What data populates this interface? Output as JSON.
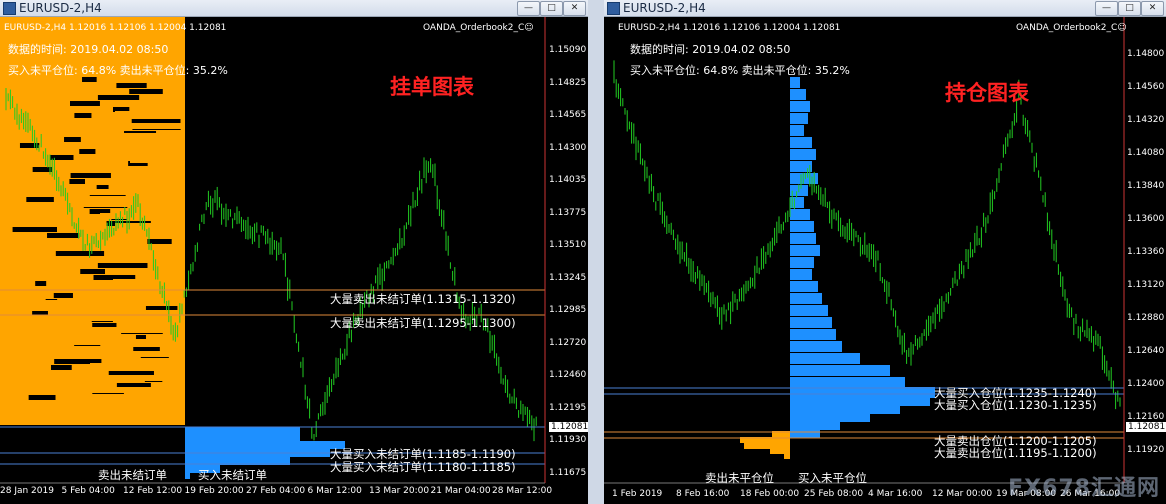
{
  "windows": {
    "left": {
      "title": "EURUSD-2,H4",
      "symbol_line": "EURUSD-2,H4  1.12016 1.12106 1.12004 1.12081",
      "indicator": "OANDA_Orderbook2_C☺",
      "time_label": "数据的时间: 2019.04.02 08:50",
      "pct_label": "买入未平仓位: 64.8%  卖出未平仓位: 35.2%",
      "big_title": "挂单图表",
      "annotations": [
        "大量卖出未结订单(1.1315-1.1320)",
        "大量卖出未结订单(1.1295-1.1300)",
        "大量买入未结订单(1.1185-1.1190)",
        "大量买入未结订单(1.1180-1.1185)"
      ],
      "bottom_labels": [
        "卖出未结订单",
        "买入未结订单"
      ],
      "price_ticks": [
        "1.15090",
        "1.14825",
        "1.14565",
        "1.14300",
        "1.14035",
        "1.13775",
        "1.13510",
        "1.13245",
        "1.12985",
        "1.12720",
        "1.12460",
        "1.12195",
        "1.11930",
        "1.11675"
      ],
      "current_price": "1.12081",
      "time_ticks": [
        "28 Jan 2019",
        "5 Feb 04:00",
        "12 Feb 12:00",
        "19 Feb 20:00",
        "27 Feb 04:00",
        "6 Mar 12:00",
        "13 Mar 20:00",
        "21 Mar 04:00",
        "28 Mar 12:00"
      ]
    },
    "right": {
      "title": "EURUSD-2,H4",
      "symbol_line": "EURUSD-2,H4  1.12016 1.12106 1.12004 1.12081",
      "indicator": "OANDA_Orderbook2_C☺",
      "time_label": "数据的时间: 2019.04.02 08:50",
      "pct_label": "买入未平仓位: 64.8%  卖出未平仓位: 35.2%",
      "big_title": "持仓图表",
      "annotations": [
        "大量买入仓位(1.1235-1.1240)",
        "大量买入仓位(1.1230-1.1235)",
        "大量卖出仓位(1.1200-1.1205)",
        "大量卖出仓位(1.1195-1.1200)"
      ],
      "bottom_labels": [
        "卖出未平仓位",
        "买入未平仓位"
      ],
      "price_ticks": [
        "1.14800",
        "1.14560",
        "1.14320",
        "1.14080",
        "1.13840",
        "1.13600",
        "1.13360",
        "1.13120",
        "1.12880",
        "1.12640",
        "1.12400",
        "1.12160",
        "1.11920"
      ],
      "current_price": "1.12081",
      "time_ticks": [
        "1 Feb 2019",
        "8 Feb 16:00",
        "18 Feb 00:00",
        "25 Feb 08:00",
        "4 Mar 16:00",
        "12 Mar 00:00",
        "19 Mar 08:00",
        "26 Mar 16:00"
      ]
    }
  },
  "watermark": "FX678汇通网",
  "colors": {
    "background": "#000000",
    "candles": "#22cc22",
    "sell_bars": "#ffa500",
    "buy_bars": "#1e90ff",
    "title_red": "#ff2222",
    "level_orange": "#e08a3a",
    "level_blue": "#4a7fd4"
  }
}
